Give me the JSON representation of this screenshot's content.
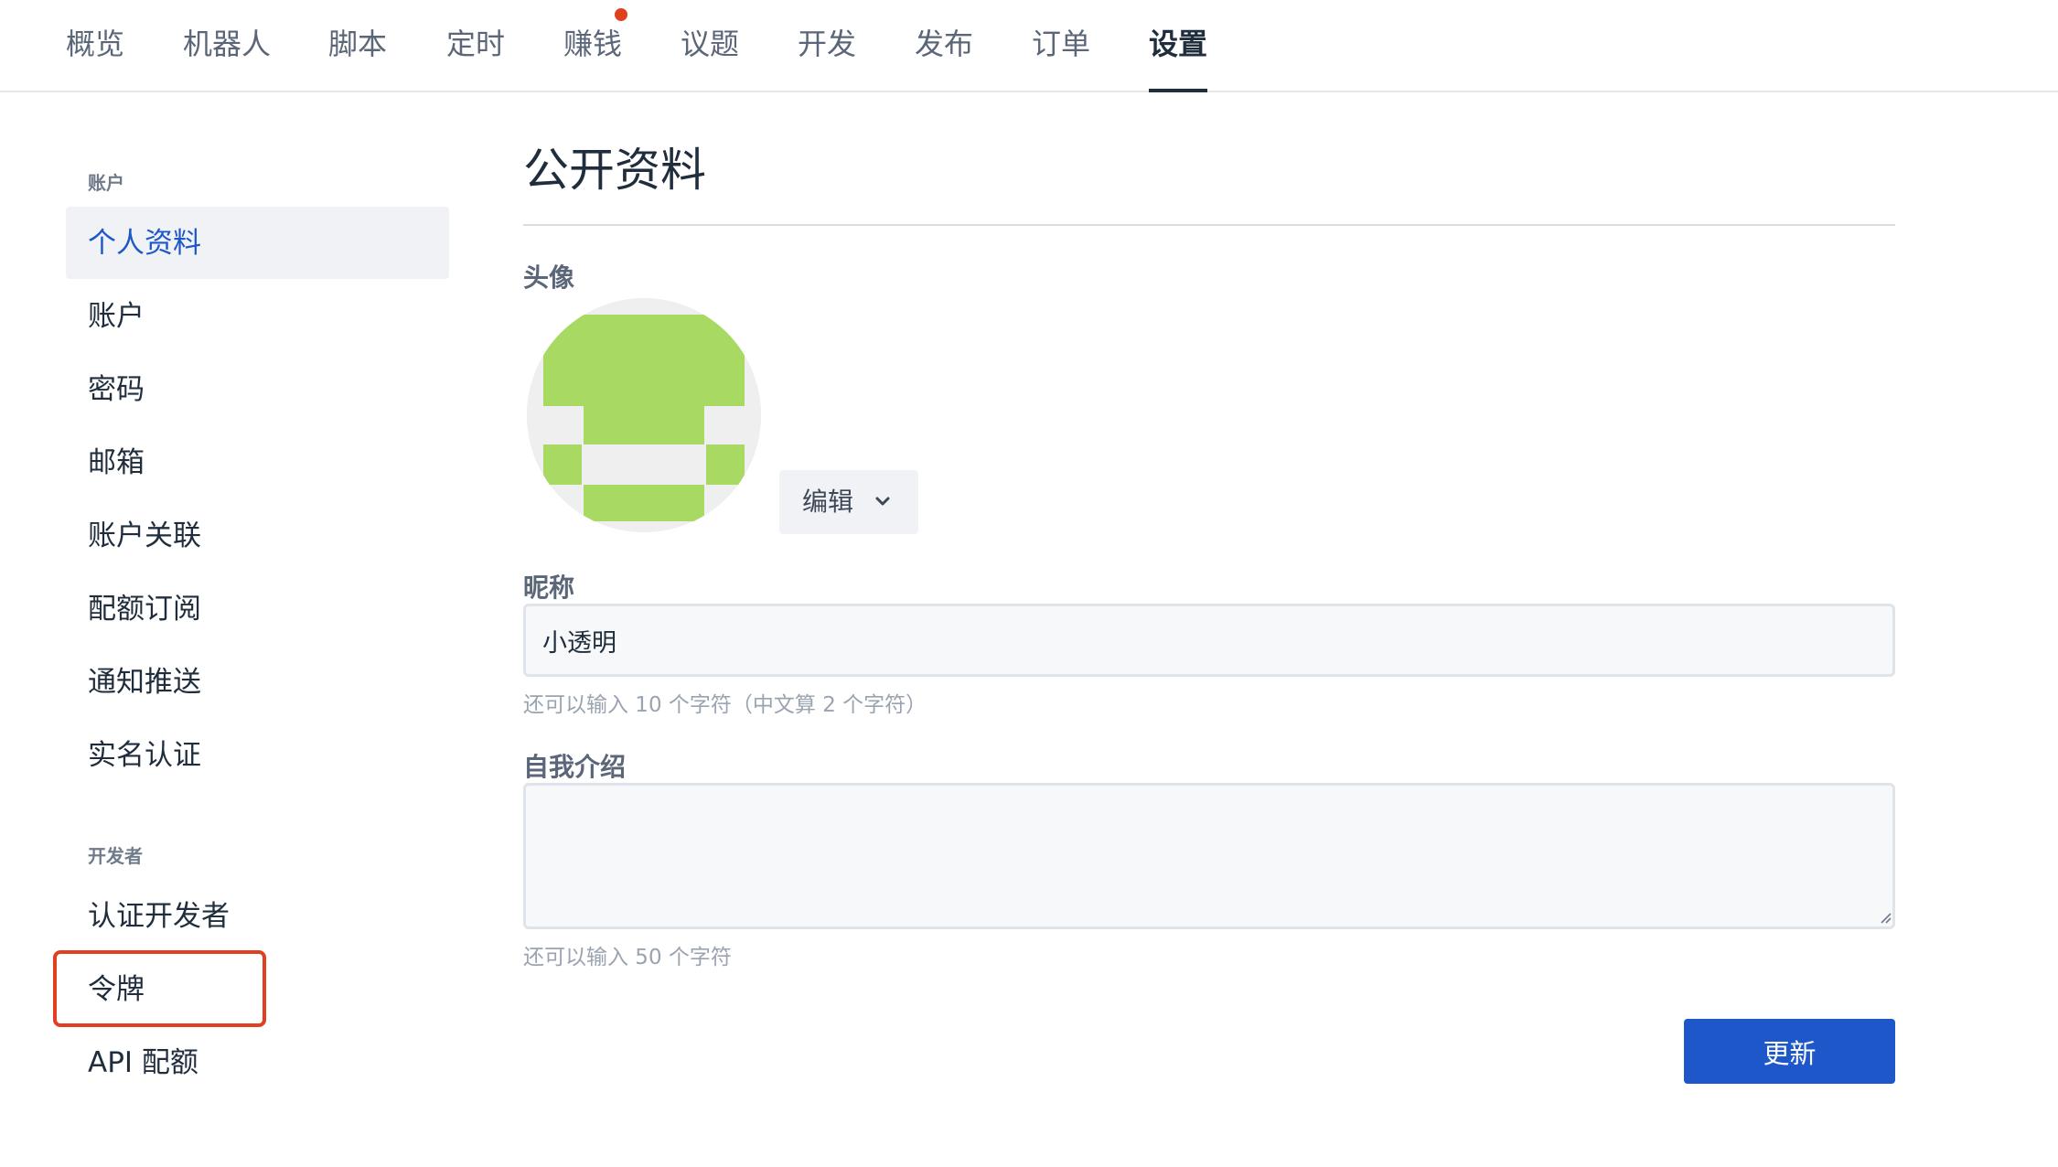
{
  "nav": {
    "tabs": [
      {
        "label": "概览"
      },
      {
        "label": "机器人"
      },
      {
        "label": "脚本"
      },
      {
        "label": "定时"
      },
      {
        "label": "赚钱"
      },
      {
        "label": "议题"
      },
      {
        "label": "开发"
      },
      {
        "label": "发布"
      },
      {
        "label": "订单"
      },
      {
        "label": "设置"
      }
    ],
    "active": "设置",
    "notification_dot_on": "赚钱"
  },
  "sidebar": {
    "groups": [
      {
        "title": "账户",
        "items": [
          {
            "label": "个人资料"
          },
          {
            "label": "账户"
          },
          {
            "label": "密码"
          },
          {
            "label": "邮箱"
          },
          {
            "label": "账户关联"
          },
          {
            "label": "配额订阅"
          },
          {
            "label": "通知推送"
          },
          {
            "label": "实名认证"
          }
        ]
      },
      {
        "title": "开发者",
        "items": [
          {
            "label": "认证开发者"
          },
          {
            "label": "令牌"
          },
          {
            "label": "API 配额"
          }
        ]
      }
    ],
    "active_item": "个人资料",
    "highlighted_item": "令牌"
  },
  "main": {
    "title": "公开资料",
    "avatar": {
      "label": "头像",
      "edit_label": "编辑",
      "edit_icon": "chevron-down-icon",
      "colors": {
        "fg": "#a8d963",
        "bg": "#efefef"
      }
    },
    "nickname": {
      "label": "昵称",
      "value": "小透明",
      "hint": "还可以输入 10 个字符（中文算 2 个字符）"
    },
    "bio": {
      "label": "自我介绍",
      "value": "",
      "hint": "还可以输入 50 个字符"
    },
    "submit_label": "更新"
  },
  "colors": {
    "accent": "#1e57c9",
    "highlight": "#e0401f",
    "notification": "#e0401f"
  }
}
